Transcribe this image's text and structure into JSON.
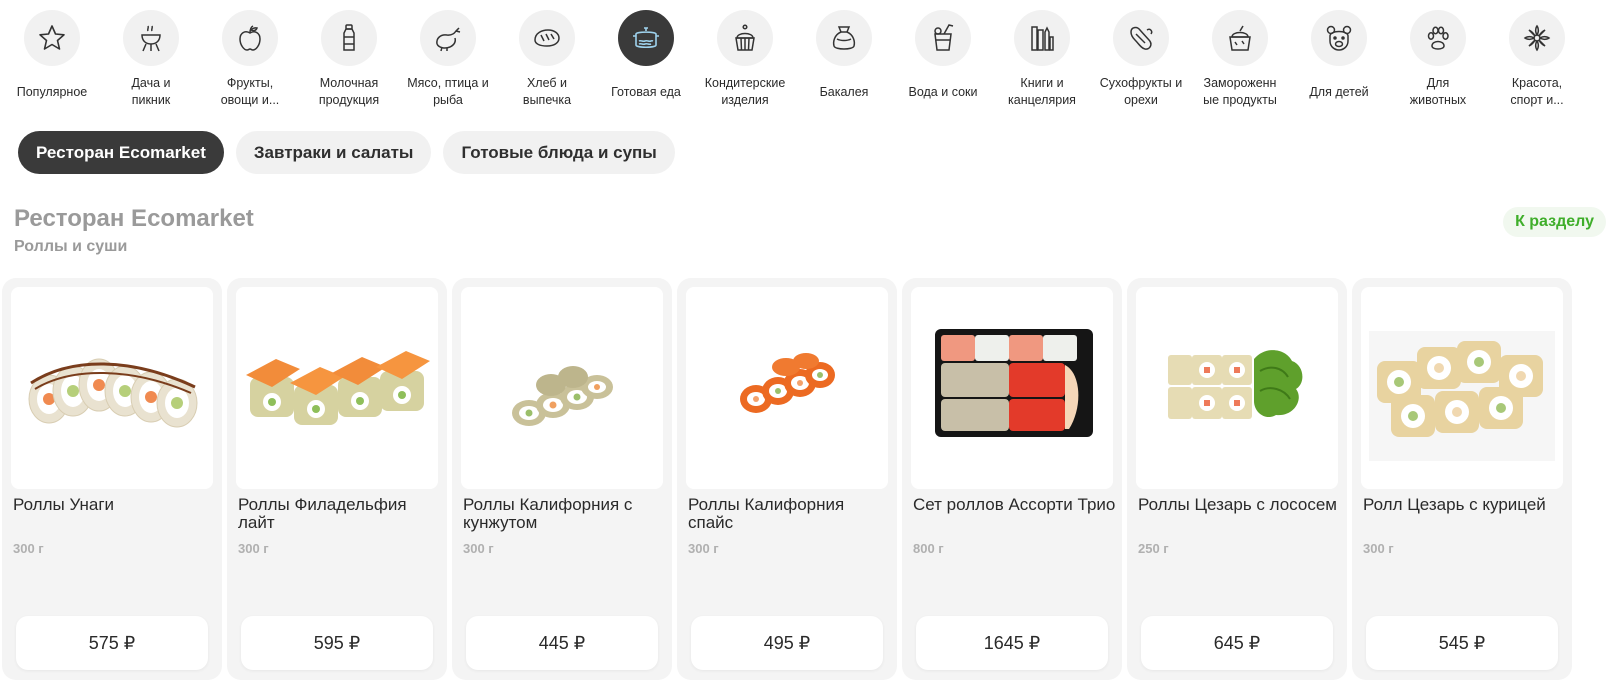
{
  "categories": [
    {
      "label": "Популярное",
      "icon": "star-icon",
      "active": false
    },
    {
      "label": "Дача и\nпикник",
      "icon": "grill-icon",
      "active": false
    },
    {
      "label": "Фрукты,\nовощи и...",
      "icon": "apple-icon",
      "active": false
    },
    {
      "label": "Молочная\nпродукция",
      "icon": "milk-bottle-icon",
      "active": false
    },
    {
      "label": "Мясо, птица и\nрыба",
      "icon": "chicken-icon",
      "active": false
    },
    {
      "label": "Хлеб и\nвыпечка",
      "icon": "bread-icon",
      "active": false
    },
    {
      "label": "Готовая еда",
      "icon": "pot-icon",
      "active": true
    },
    {
      "label": "Кондитерские\nизделия",
      "icon": "cupcake-icon",
      "active": false
    },
    {
      "label": "Бакалея",
      "icon": "sack-icon",
      "active": false
    },
    {
      "label": "Вода и соки",
      "icon": "drink-icon",
      "active": false
    },
    {
      "label": "Книги и\nканцелярия",
      "icon": "stationery-icon",
      "active": false
    },
    {
      "label": "Сухофрукты и\nорехи",
      "icon": "nuts-icon",
      "active": false
    },
    {
      "label": "Замороженн\nые продукты",
      "icon": "ice-cream-icon",
      "active": false
    },
    {
      "label": "Для детей",
      "icon": "bear-icon",
      "active": false
    },
    {
      "label": "Для\nживотных",
      "icon": "paw-icon",
      "active": false
    },
    {
      "label": "Красота,\nспорт и...",
      "icon": "flower-icon",
      "active": false
    }
  ],
  "subtabs": [
    {
      "label": "Ресторан Ecomarket",
      "active": true
    },
    {
      "label": "Завтраки и салаты",
      "active": false
    },
    {
      "label": "Готовые блюда и супы",
      "active": false
    }
  ],
  "section": {
    "title": "Ресторан Ecomarket",
    "subtitle": "Роллы и суши",
    "link": "К разделу"
  },
  "products": [
    {
      "name": "Роллы Унаги",
      "weight": "300 г",
      "price": "575 ₽",
      "image": "unagi-rolls"
    },
    {
      "name": "Роллы Филадельфия лайт",
      "weight": "300 г",
      "price": "595 ₽",
      "image": "philadelphia-rolls"
    },
    {
      "name": "Роллы Калифорния с кунжутом",
      "weight": "300 г",
      "price": "445 ₽",
      "image": "california-sesame-rolls"
    },
    {
      "name": "Роллы Калифорния спайс",
      "weight": "300 г",
      "price": "495 ₽",
      "image": "california-spice-rolls"
    },
    {
      "name": "Сет роллов Ассорти Трио",
      "weight": "800 г",
      "price": "1645 ₽",
      "image": "assorti-trio-set"
    },
    {
      "name": "Роллы Цезарь с лососем",
      "weight": "250 г",
      "price": "645 ₽",
      "image": "caesar-salmon-rolls"
    },
    {
      "name": "Ролл Цезарь с курицей",
      "weight": "300 г",
      "price": "545 ₽",
      "image": "caesar-chicken-rolls"
    }
  ],
  "colors": {
    "accent_green": "#3fae2a",
    "chip_dark": "#3a3a3a",
    "chip_light": "#f1f1f1",
    "card_bg": "#f4f4f4"
  }
}
